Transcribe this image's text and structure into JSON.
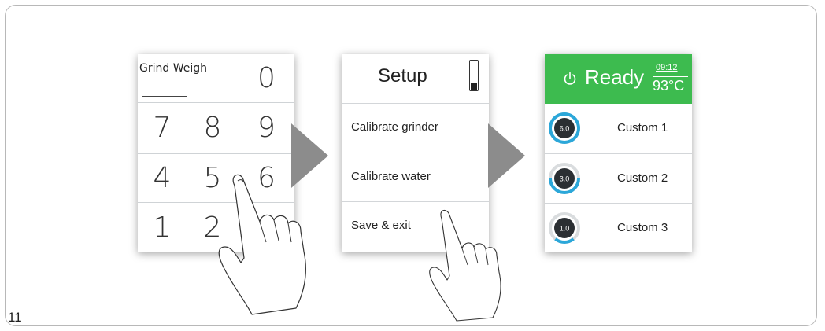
{
  "figure_number": "11",
  "keypad": {
    "label": "Grind Weigh",
    "keys": {
      "zero": "0",
      "row1": [
        "7",
        "8",
        "9"
      ],
      "row2": [
        "4",
        "5",
        "6"
      ],
      "row3": [
        "1",
        "2"
      ]
    }
  },
  "setup": {
    "title": "Setup",
    "battery_level_fraction": 0.25,
    "items": [
      "Calibrate grinder",
      "Calibrate water",
      "Save & exit"
    ]
  },
  "ready": {
    "status": "Ready",
    "time": "09:12",
    "temperature": "93°C",
    "header_color": "#3dbb4f",
    "gauge_color": "#2ba7d9",
    "presets": [
      {
        "value": "6.0",
        "name": "Custom 1",
        "fill_fraction": 1.0
      },
      {
        "value": "3.0",
        "name": "Custom 2",
        "fill_fraction": 0.5
      },
      {
        "value": "1.0",
        "name": "Custom 3",
        "fill_fraction": 0.22
      }
    ]
  },
  "icons": {
    "arrow": "chevron-right-arrow-icon",
    "hand": "pointing-hand-icon",
    "power": "power-icon",
    "battery": "battery-icon"
  }
}
